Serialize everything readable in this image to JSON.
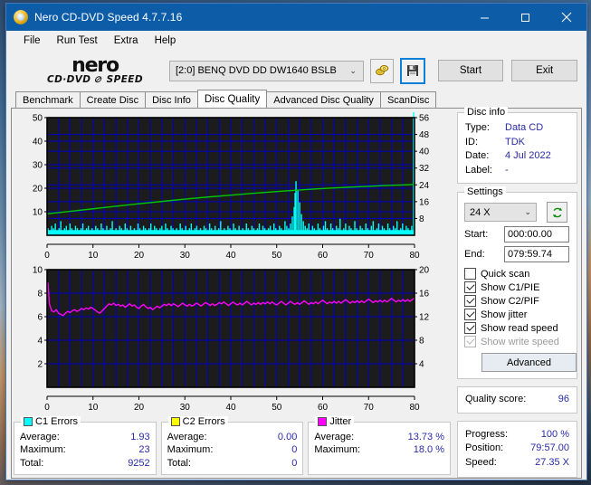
{
  "window": {
    "title": "Nero CD-DVD Speed 4.7.7.16",
    "icon": "nero-disc-icon",
    "minimize": "minimize-icon",
    "maximize": "maximize-icon",
    "close": "close-icon"
  },
  "menu": [
    "File",
    "Run Test",
    "Extra",
    "Help"
  ],
  "logo": {
    "name": "nero",
    "subtitle_left": "CD·DVD",
    "subtitle_right": "SPEED"
  },
  "toolbar": {
    "drive": "[2:0]   BENQ DVD DD DW1640 BSLB",
    "drive_arrow": "⌄",
    "eject_icon": "eject-disc-icon",
    "save_icon": "floppy-save-icon",
    "start_label": "Start",
    "exit_label": "Exit"
  },
  "tabs": [
    {
      "label": "Benchmark",
      "active": false
    },
    {
      "label": "Create Disc",
      "active": false
    },
    {
      "label": "Disc Info",
      "active": false
    },
    {
      "label": "Disc Quality",
      "active": true
    },
    {
      "label": "Advanced Disc Quality",
      "active": false
    },
    {
      "label": "ScanDisc",
      "active": false
    }
  ],
  "disc_info": {
    "caption": "Disc info",
    "type_label": "Type:",
    "type_value": "Data CD",
    "id_label": "ID:",
    "id_value": "TDK",
    "date_label": "Date:",
    "date_value": "4 Jul 2022",
    "label_label": "Label:",
    "label_value": "-"
  },
  "settings": {
    "caption": "Settings",
    "speed": "24 X",
    "speed_arrow": "⌄",
    "refresh_icon": "refresh-arrows-icon",
    "start_label": "Start:",
    "start_value": "000:00.00",
    "end_label": "End:",
    "end_value": "079:59.74",
    "checkboxes": [
      {
        "label": "Quick scan",
        "checked": false,
        "disabled": false
      },
      {
        "label": "Show C1/PIE",
        "checked": true,
        "disabled": false
      },
      {
        "label": "Show C2/PIF",
        "checked": true,
        "disabled": false
      },
      {
        "label": "Show jitter",
        "checked": true,
        "disabled": false
      },
      {
        "label": "Show read speed",
        "checked": true,
        "disabled": false
      },
      {
        "label": "Show write speed",
        "checked": true,
        "disabled": true
      }
    ],
    "advanced_label": "Advanced"
  },
  "quality": {
    "label": "Quality score:",
    "value": "96"
  },
  "progress": {
    "progress_label": "Progress:",
    "progress_value": "100 %",
    "position_label": "Position:",
    "position_value": "79:57.00",
    "speed_label": "Speed:",
    "speed_value": "27.35 X"
  },
  "stats": {
    "c1": {
      "caption": "C1 Errors",
      "color": "#00ffff",
      "rows": [
        {
          "k": "Average:",
          "v": "1.93"
        },
        {
          "k": "Maximum:",
          "v": "23"
        },
        {
          "k": "Total:",
          "v": "9252"
        }
      ]
    },
    "c2": {
      "caption": "C2 Errors",
      "color": "#ffff00",
      "rows": [
        {
          "k": "Average:",
          "v": "0.00"
        },
        {
          "k": "Maximum:",
          "v": "0"
        },
        {
          "k": "Total:",
          "v": "0"
        }
      ]
    },
    "jitter": {
      "caption": "Jitter",
      "color": "#ff00ff",
      "rows": [
        {
          "k": "Average:",
          "v": "13.73 %"
        },
        {
          "k": "Maximum:",
          "v": "18.0 %"
        }
      ]
    }
  },
  "chart_data": [
    {
      "type": "area",
      "name": "c1-errors-chart",
      "title": "",
      "xlabel": "",
      "ylabel": "",
      "xlim": [
        0,
        80
      ],
      "xticks": [
        0,
        10,
        20,
        30,
        40,
        50,
        60,
        70,
        80
      ],
      "ylim": [
        0,
        50
      ],
      "yticks": [
        10,
        20,
        30,
        40,
        50
      ],
      "y2lim": [
        0,
        56
      ],
      "y2ticks": [
        8,
        16,
        24,
        32,
        40,
        48,
        56
      ],
      "grid": true,
      "plot_bg": "#1c1c1c",
      "grid_color": "#0000c8",
      "series": [
        {
          "name": "C1 Errors",
          "color": "#00ffff",
          "style": "impulse",
          "axis": "left",
          "x": [
            0.2,
            0.6,
            1.0,
            1.4,
            1.8,
            2.2,
            2.6,
            3.0,
            3.4,
            3.8,
            4.2,
            4.6,
            5.0,
            5.4,
            5.8,
            6.2,
            6.6,
            7.0,
            7.4,
            7.8,
            8.2,
            8.6,
            9.0,
            9.4,
            9.8,
            10.2,
            10.6,
            11.0,
            11.4,
            11.8,
            12.2,
            12.6,
            13.0,
            13.4,
            13.8,
            14.2,
            14.6,
            15.0,
            15.4,
            15.8,
            16.2,
            16.6,
            17.0,
            17.4,
            17.8,
            18.2,
            18.6,
            19.0,
            19.4,
            19.8,
            20.2,
            20.6,
            21.0,
            21.4,
            21.8,
            22.2,
            22.6,
            23.0,
            23.4,
            23.8,
            24.2,
            24.6,
            25.0,
            25.4,
            25.8,
            26.2,
            26.6,
            27.0,
            27.4,
            27.8,
            28.2,
            28.6,
            29.0,
            29.4,
            29.8,
            30.2,
            30.6,
            31.0,
            31.4,
            31.8,
            32.2,
            32.6,
            33.0,
            33.4,
            33.8,
            34.2,
            34.6,
            35.0,
            35.4,
            35.8,
            36.2,
            36.6,
            37.0,
            37.4,
            37.8,
            38.2,
            38.6,
            39.0,
            39.4,
            39.8,
            40.2,
            40.6,
            41.0,
            41.4,
            41.8,
            42.2,
            42.6,
            43.0,
            43.4,
            43.8,
            44.2,
            44.6,
            45.0,
            45.4,
            45.8,
            46.2,
            46.6,
            47.0,
            47.4,
            47.8,
            48.2,
            48.6,
            49.0,
            49.4,
            49.8,
            50.2,
            50.6,
            51.0,
            51.4,
            51.8,
            52.2,
            52.6,
            53.0,
            53.4,
            53.8,
            54.0,
            54.2,
            54.6,
            55.0,
            55.4,
            55.8,
            56.2,
            56.6,
            57.0,
            57.4,
            57.8,
            58.2,
            58.6,
            59.0,
            59.4,
            59.8,
            60.2,
            60.6,
            61.0,
            61.4,
            61.8,
            62.2,
            62.6,
            63.0,
            63.4,
            63.8,
            64.2,
            64.6,
            65.0,
            65.4,
            65.8,
            66.2,
            66.6,
            67.0,
            67.4,
            67.8,
            68.2,
            68.6,
            69.0,
            69.4,
            69.8,
            70.2,
            70.6,
            71.0,
            71.4,
            71.8,
            72.2,
            72.6,
            73.0,
            73.4,
            73.8,
            74.2,
            74.6,
            75.0,
            75.4,
            75.8,
            76.2,
            76.6,
            77.0,
            77.4,
            77.8,
            78.2,
            78.6,
            79.0,
            79.4,
            79.8
          ],
          "y": [
            3,
            2,
            4,
            3,
            5,
            2,
            3,
            6,
            2,
            3,
            4,
            2,
            5,
            3,
            2,
            4,
            3,
            2,
            3,
            5,
            2,
            3,
            4,
            2,
            3,
            2,
            4,
            3,
            2,
            5,
            3,
            2,
            4,
            2,
            3,
            6,
            2,
            3,
            2,
            4,
            3,
            2,
            5,
            3,
            2,
            4,
            2,
            3,
            2,
            5,
            3,
            2,
            4,
            3,
            2,
            3,
            5,
            2,
            4,
            3,
            2,
            3,
            4,
            2,
            5,
            3,
            2,
            4,
            3,
            2,
            3,
            2,
            5,
            3,
            2,
            4,
            2,
            3,
            5,
            2,
            3,
            4,
            2,
            3,
            2,
            4,
            3,
            2,
            5,
            3,
            2,
            4,
            2,
            3,
            6,
            2,
            3,
            2,
            4,
            3,
            2,
            5,
            3,
            2,
            4,
            2,
            3,
            2,
            5,
            3,
            2,
            4,
            3,
            2,
            3,
            5,
            2,
            4,
            3,
            2,
            3,
            4,
            2,
            5,
            3,
            2,
            4,
            3,
            2,
            6,
            4,
            3,
            5,
            8,
            12,
            18,
            23,
            19,
            14,
            9,
            6,
            4,
            3,
            5,
            2,
            4,
            3,
            2,
            5,
            3,
            2,
            4,
            6,
            3,
            2,
            5,
            3,
            2,
            4,
            3,
            7,
            2,
            3,
            5,
            2,
            4,
            3,
            2,
            6,
            3,
            2,
            4,
            3,
            2,
            5,
            3,
            2,
            4,
            6,
            2,
            3,
            5,
            2,
            4,
            3,
            2,
            5,
            3,
            2,
            4,
            3,
            6,
            2,
            3,
            5,
            2,
            4,
            3,
            2,
            4
          ]
        },
        {
          "name": "Read speed",
          "color": "#00c800",
          "style": "line",
          "axis": "right",
          "x": [
            0,
            5,
            10,
            15,
            20,
            25,
            30,
            35,
            40,
            45,
            50,
            54,
            58,
            62,
            66,
            70,
            74,
            78,
            80
          ],
          "y": [
            10.2,
            11.4,
            12.6,
            13.8,
            15.0,
            16.1,
            17.2,
            18.2,
            19.1,
            20.0,
            20.8,
            21.4,
            22.0,
            22.5,
            22.9,
            23.3,
            23.7,
            24.0,
            24.2
          ]
        }
      ]
    },
    {
      "type": "line",
      "name": "jitter-chart",
      "title": "",
      "xlabel": "",
      "ylabel": "",
      "xlim": [
        0,
        80
      ],
      "xticks": [
        0,
        10,
        20,
        30,
        40,
        50,
        60,
        70,
        80
      ],
      "ylim": [
        0,
        10
      ],
      "yticks": [
        2,
        4,
        6,
        8,
        10
      ],
      "y2lim": [
        0,
        20
      ],
      "y2ticks": [
        4,
        8,
        12,
        16,
        20
      ],
      "grid": true,
      "plot_bg": "#1c1c1c",
      "grid_color": "#0000c8",
      "series": [
        {
          "name": "Jitter",
          "color": "#ff00ff",
          "style": "line",
          "axis": "right",
          "x": [
            0.2,
            0.5,
            1,
            1.5,
            2,
            2.5,
            3,
            3.5,
            4,
            4.5,
            5,
            5.5,
            6,
            6.5,
            7,
            7.5,
            8,
            8.5,
            9,
            9.5,
            10,
            10.5,
            11,
            11.5,
            12,
            12.5,
            13,
            13.5,
            14,
            14.5,
            15,
            15.5,
            16,
            16.5,
            17,
            17.5,
            18,
            18.5,
            19,
            19.5,
            20,
            20.5,
            21,
            21.5,
            22,
            22.5,
            23,
            23.5,
            24,
            24.5,
            25,
            25.5,
            26,
            26.5,
            27,
            27.5,
            28,
            28.5,
            29,
            29.5,
            30,
            30.5,
            31,
            31.5,
            32,
            32.5,
            33,
            33.5,
            34,
            34.5,
            35,
            35.5,
            36,
            36.5,
            37,
            37.5,
            38,
            38.5,
            39,
            39.5,
            40,
            40.5,
            41,
            41.5,
            42,
            42.5,
            43,
            43.5,
            44,
            44.5,
            45,
            45.5,
            46,
            46.5,
            47,
            47.5,
            48,
            48.5,
            49,
            49.5,
            50,
            50.5,
            51,
            51.5,
            52,
            52.5,
            53,
            53.5,
            54,
            54.5,
            55,
            55.5,
            56,
            56.5,
            57,
            57.5,
            58,
            58.5,
            59,
            59.5,
            60,
            60.5,
            61,
            61.5,
            62,
            62.5,
            63,
            63.5,
            64,
            64.5,
            65,
            65.5,
            66,
            66.5,
            67,
            67.5,
            68,
            68.5,
            69,
            69.5,
            70,
            70.5,
            71,
            71.5,
            72,
            72.5,
            73,
            73.5,
            74,
            74.5,
            75,
            75.5,
            76,
            76.5,
            77,
            77.5,
            78,
            78.5,
            79,
            79.5,
            80
          ],
          "y": [
            17.8,
            14.2,
            13.0,
            12.8,
            13.2,
            12.6,
            12.4,
            12.2,
            12.6,
            12.9,
            12.7,
            13.0,
            13.2,
            12.9,
            13.1,
            13.4,
            13.2,
            13.5,
            13.3,
            13.6,
            13.4,
            13.1,
            12.8,
            12.6,
            13.0,
            13.4,
            13.8,
            14.2,
            14.0,
            14.3,
            13.9,
            14.1,
            13.8,
            14.0,
            13.6,
            13.9,
            14.2,
            13.8,
            14.0,
            13.6,
            13.4,
            13.8,
            14.1,
            13.7,
            13.4,
            13.6,
            13.2,
            13.5,
            13.8,
            13.5,
            13.8,
            14.1,
            13.9,
            14.2,
            13.9,
            14.2,
            14.0,
            13.7,
            14.0,
            14.3,
            14.0,
            13.8,
            14.1,
            13.8,
            14.0,
            14.3,
            14.1,
            13.8,
            14.1,
            14.4,
            14.2,
            13.9,
            14.2,
            13.9,
            14.1,
            14.4,
            14.2,
            14.5,
            14.2,
            13.9,
            14.2,
            14.5,
            14.2,
            14.0,
            14.3,
            14.0,
            14.3,
            14.6,
            14.3,
            14.0,
            14.3,
            14.1,
            14.4,
            14.1,
            14.4,
            14.2,
            14.5,
            14.2,
            14.5,
            14.2,
            14.0,
            14.3,
            14.6,
            14.3,
            14.0,
            14.3,
            14.6,
            14.3,
            14.1,
            14.4,
            14.1,
            14.4,
            14.7,
            14.4,
            14.1,
            14.4,
            14.2,
            14.5,
            14.2,
            14.5,
            14.8,
            14.5,
            14.2,
            14.5,
            14.3,
            14.6,
            14.3,
            14.6,
            14.3,
            14.6,
            14.9,
            14.6,
            14.3,
            14.6,
            14.4,
            14.7,
            14.4,
            14.7,
            14.4,
            14.7,
            15.0,
            14.7,
            14.4,
            14.7,
            14.5,
            14.8,
            14.5,
            14.8,
            14.5,
            14.8,
            15.1,
            14.8,
            14.5,
            14.8,
            14.6,
            14.9,
            14.6,
            14.9,
            14.6,
            14.9,
            15.2
          ]
        }
      ]
    }
  ]
}
